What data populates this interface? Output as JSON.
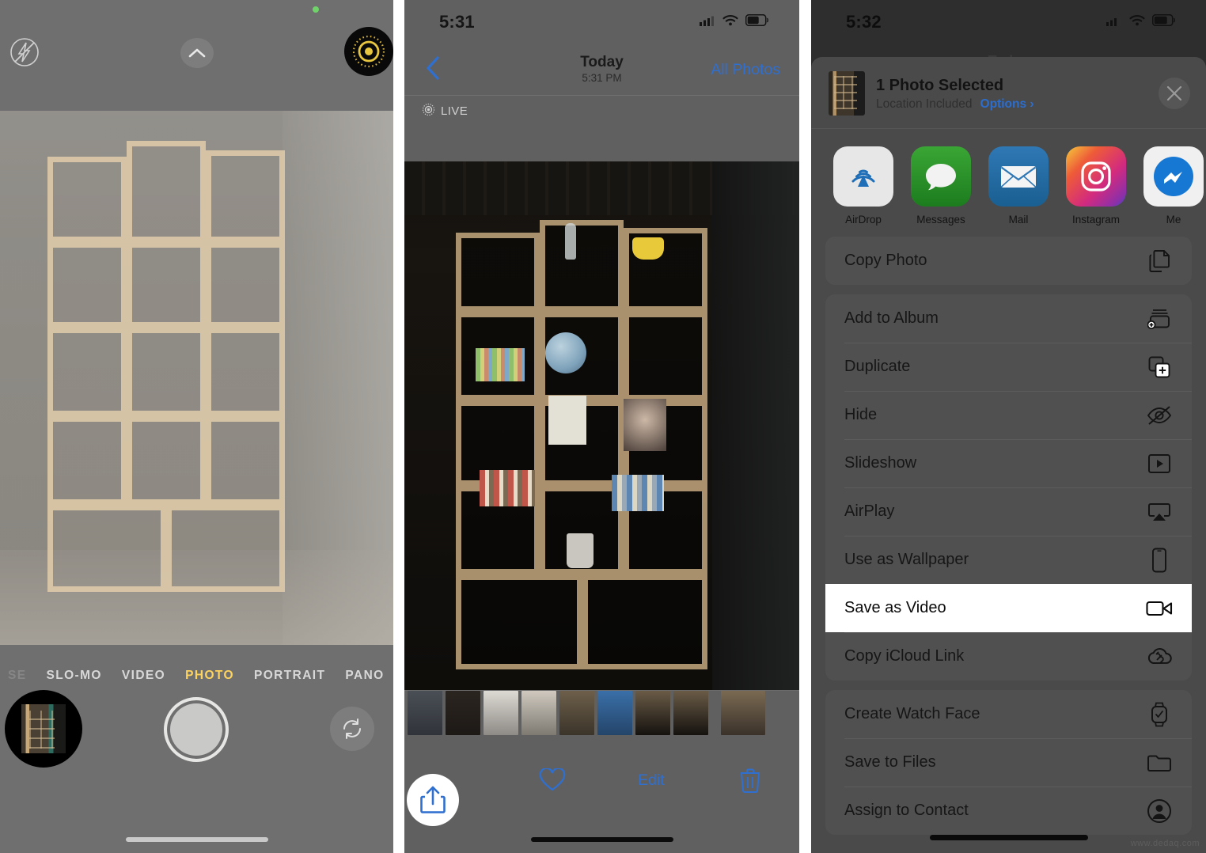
{
  "camera": {
    "icons": {
      "flash": "flash-off-icon",
      "chevron": "chevron-up-icon",
      "live": "live-photo-icon",
      "flip": "camera-flip-icon",
      "recording_dot": "green-recording-dot"
    },
    "modes": [
      {
        "label": "SE",
        "state": "dim"
      },
      {
        "label": "SLO-MO",
        "state": "normal"
      },
      {
        "label": "VIDEO",
        "state": "normal"
      },
      {
        "label": "PHOTO",
        "state": "active"
      },
      {
        "label": "PORTRAIT",
        "state": "normal"
      },
      {
        "label": "PANO",
        "state": "normal"
      }
    ],
    "active_mode": "PHOTO",
    "shutter_label": "shutter-button",
    "thumbnail_label": "last-photo-thumbnail",
    "accent_yellow": "#ffd45e"
  },
  "photos": {
    "status": {
      "time": "5:31",
      "cellular": "signal-bars-icon",
      "wifi": "wifi-icon",
      "battery": "battery-icon"
    },
    "nav": {
      "back": "back-chevron",
      "title": "Today",
      "subtitle": "5:31 PM",
      "right_action": "All Photos"
    },
    "live_badge": "LIVE",
    "toolbar": {
      "share": "Share",
      "favorite": "Favorite",
      "edit": "Edit",
      "delete": "Delete"
    },
    "accent_blue": "#2f6fd0"
  },
  "share_sheet": {
    "status": {
      "time": "5:32",
      "cellular": "signal-bars-icon",
      "wifi": "wifi-icon",
      "battery": "battery-icon"
    },
    "behind_title": "Today",
    "header": {
      "title": "1 Photo Selected",
      "location": "Location Included",
      "options": "Options",
      "options_chevron": "chevron-right-icon",
      "close": "close-icon"
    },
    "apps": [
      {
        "label": "AirDrop",
        "icon": "airdrop-icon"
      },
      {
        "label": "Messages",
        "icon": "messages-icon"
      },
      {
        "label": "Mail",
        "icon": "mail-icon"
      },
      {
        "label": "Instagram",
        "icon": "instagram-icon"
      },
      {
        "label": "Me",
        "icon": "messenger-icon"
      }
    ],
    "groups": [
      {
        "rows": [
          {
            "label": "Copy Photo",
            "icon": "copy-icon",
            "selected": false
          }
        ]
      },
      {
        "rows": [
          {
            "label": "Add to Album",
            "icon": "add-to-album-icon",
            "selected": false
          },
          {
            "label": "Duplicate",
            "icon": "duplicate-icon",
            "selected": false
          },
          {
            "label": "Hide",
            "icon": "hide-eye-icon",
            "selected": false
          },
          {
            "label": "Slideshow",
            "icon": "slideshow-icon",
            "selected": false
          },
          {
            "label": "AirPlay",
            "icon": "airplay-icon",
            "selected": false
          },
          {
            "label": "Use as Wallpaper",
            "icon": "wallpaper-icon",
            "selected": false
          },
          {
            "label": "Save as Video",
            "icon": "video-camera-icon",
            "selected": true
          },
          {
            "label": "Copy iCloud Link",
            "icon": "icloud-link-icon",
            "selected": false
          }
        ]
      },
      {
        "rows": [
          {
            "label": "Create Watch Face",
            "icon": "watch-icon",
            "selected": false
          },
          {
            "label": "Save to Files",
            "icon": "folder-icon",
            "selected": false
          },
          {
            "label": "Assign to Contact",
            "icon": "contact-icon",
            "selected": false
          }
        ]
      }
    ],
    "highlight_color": "#ffffff",
    "accent_blue": "#2b6ed0"
  },
  "watermark": "www.dedaq.com"
}
